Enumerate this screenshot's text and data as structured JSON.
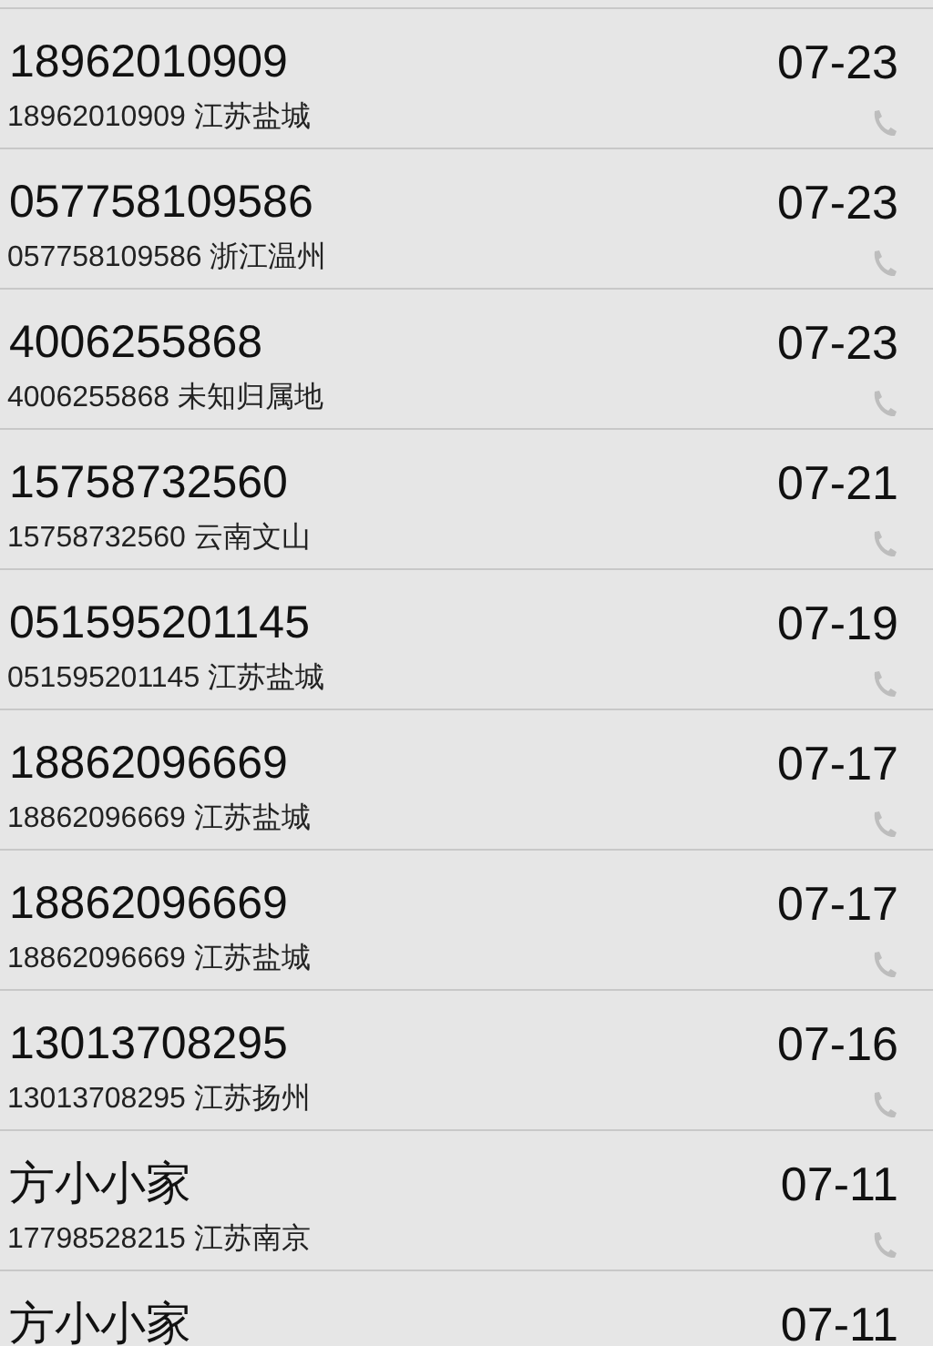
{
  "calls": [
    {
      "name": "18962010909",
      "detail": "18962010909 江苏盐城",
      "date": "07-23"
    },
    {
      "name": "057758109586",
      "detail": "057758109586 浙江温州",
      "date": "07-23"
    },
    {
      "name": "4006255868",
      "detail": "4006255868 未知归属地",
      "date": "07-23"
    },
    {
      "name": "15758732560",
      "detail": "15758732560 云南文山",
      "date": "07-21"
    },
    {
      "name": "051595201145",
      "detail": "051595201145 江苏盐城",
      "date": "07-19"
    },
    {
      "name": "18862096669",
      "detail": "18862096669 江苏盐城",
      "date": "07-17"
    },
    {
      "name": "18862096669",
      "detail": "18862096669 江苏盐城",
      "date": "07-17"
    },
    {
      "name": "13013708295",
      "detail": "13013708295 江苏扬州",
      "date": "07-16"
    },
    {
      "name": "方小小家",
      "detail": "17798528215 江苏南京",
      "date": "07-11"
    },
    {
      "name": "方小小家",
      "date": "07-11"
    }
  ]
}
